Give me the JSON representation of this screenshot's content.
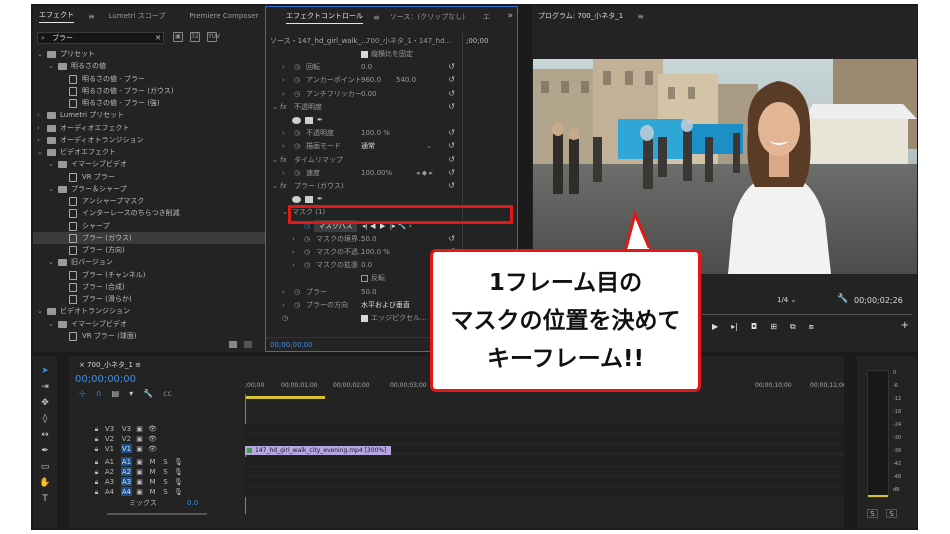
{
  "effects_panel": {
    "tabs": [
      "エフェクト",
      "Lumetri スコープ",
      "Premiere Composer"
    ],
    "search_value": "ブラー",
    "tree": [
      {
        "label": "プリセット",
        "level": 0,
        "type": "folder",
        "expanded": true
      },
      {
        "label": "明るさの値",
        "level": 1,
        "type": "folder",
        "expanded": true
      },
      {
        "label": "明るさの値 - ブラー",
        "level": 2,
        "type": "preset"
      },
      {
        "label": "明るさの値 - ブラー (ガウス)",
        "level": 2,
        "type": "preset"
      },
      {
        "label": "明るさの値 - ブラー (強)",
        "level": 2,
        "type": "preset"
      },
      {
        "label": "Lumetri プリセット",
        "level": 0,
        "type": "folder",
        "expanded": false
      },
      {
        "label": "オーディオエフェクト",
        "level": 0,
        "type": "folder",
        "expanded": false
      },
      {
        "label": "オーディオトランジション",
        "level": 0,
        "type": "folder",
        "expanded": false
      },
      {
        "label": "ビデオエフェクト",
        "level": 0,
        "type": "folder",
        "expanded": true
      },
      {
        "label": "イマーシブビデオ",
        "level": 1,
        "type": "folder",
        "expanded": true
      },
      {
        "label": "VR ブラー",
        "level": 2,
        "type": "effect"
      },
      {
        "label": "ブラー＆シャープ",
        "level": 1,
        "type": "folder",
        "expanded": true
      },
      {
        "label": "アンシャープマスク",
        "level": 2,
        "type": "effect"
      },
      {
        "label": "インターレースのちらつき削減",
        "level": 2,
        "type": "effect"
      },
      {
        "label": "シャープ",
        "level": 2,
        "type": "effect"
      },
      {
        "label": "ブラー (ガウス)",
        "level": 2,
        "type": "effect",
        "selected": true
      },
      {
        "label": "ブラー (方向)",
        "level": 2,
        "type": "effect"
      },
      {
        "label": "旧バージョン",
        "level": 1,
        "type": "folder",
        "expanded": true
      },
      {
        "label": "ブラー (チャンネル)",
        "level": 2,
        "type": "effect"
      },
      {
        "label": "ブラー (合成)",
        "level": 2,
        "type": "effect"
      },
      {
        "label": "ブラー (滑らか)",
        "level": 2,
        "type": "effect"
      },
      {
        "label": "ビデオトランジション",
        "level": 0,
        "type": "folder",
        "expanded": true
      },
      {
        "label": "イマーシブビデオ",
        "level": 1,
        "type": "folder",
        "expanded": true
      },
      {
        "label": "VR ブラー (球面)",
        "level": 2,
        "type": "effect"
      }
    ]
  },
  "effect_controls": {
    "tabs": [
      "エフェクトコントロール",
      "ソース：(クリップなし)",
      "エ"
    ],
    "source_label": "ソース・147_hd_girl_walk_...",
    "seq_label": "700_小ネタ_1・147_hd...",
    "ruler_time": ";00;00",
    "rows": [
      {
        "id": "uniform",
        "indent": 2,
        "label": "",
        "value": "縦横比を固定",
        "kind": "checkbox"
      },
      {
        "id": "rotate",
        "indent": 1,
        "label": "回転",
        "value": "0.0",
        "kind": "param"
      },
      {
        "id": "anchor",
        "indent": 1,
        "label": "アンカーポイント",
        "value": "960.0",
        "value2": "540.0",
        "kind": "param"
      },
      {
        "id": "flicker",
        "indent": 1,
        "label": "アンチフリッカー",
        "value": "0.00",
        "kind": "param"
      },
      {
        "id": "opacity_h",
        "indent": 0,
        "label": "不透明度",
        "kind": "header"
      },
      {
        "id": "opacity_shapes",
        "indent": 1,
        "kind": "shapes"
      },
      {
        "id": "opacity",
        "indent": 1,
        "label": "不透明度",
        "value": "100.0 %",
        "kind": "param"
      },
      {
        "id": "blend",
        "indent": 1,
        "label": "描画モード",
        "value": "通常",
        "kind": "select"
      },
      {
        "id": "timeremap_h",
        "indent": 0,
        "label": "タイムリマップ",
        "kind": "header"
      },
      {
        "id": "speed",
        "indent": 1,
        "label": "速度",
        "value": "100.00%",
        "kind": "param"
      },
      {
        "id": "blur_h",
        "indent": 0,
        "label": "ブラー (ガウス)",
        "kind": "header"
      },
      {
        "id": "blur_shapes",
        "indent": 1,
        "kind": "shapes"
      },
      {
        "id": "mask_h",
        "indent": 1,
        "label": "マスク (1)",
        "kind": "subheader"
      },
      {
        "id": "maskpath",
        "indent": 2,
        "label": "マスクパス",
        "kind": "maskpath"
      },
      {
        "id": "feather",
        "indent": 2,
        "label": "マスクの境界...",
        "value": "50.0",
        "kind": "param"
      },
      {
        "id": "maskopac",
        "indent": 2,
        "label": "マスクの不透...",
        "value": "100.0 %",
        "kind": "param"
      },
      {
        "id": "expand",
        "indent": 2,
        "label": "マスクの拡張",
        "value": "0.0",
        "kind": "param"
      },
      {
        "id": "invert",
        "indent": 2,
        "label": "",
        "value": "反転",
        "kind": "checkbox_off"
      },
      {
        "id": "blurriness",
        "indent": 1,
        "label": "ブラー",
        "value": "50.0",
        "kind": "param"
      },
      {
        "id": "blurdir",
        "indent": 1,
        "label": "ブラーの方向",
        "value": "水平および垂直",
        "kind": "text"
      },
      {
        "id": "repeat",
        "indent": 1,
        "label": "",
        "value": "エッジピクセル...",
        "kind": "checkbox"
      }
    ],
    "timecode": "00;00;00;00"
  },
  "program": {
    "title": "プログラム: 700_小ネタ_1",
    "resolution": "1/4",
    "timecode": "00;00;02;26"
  },
  "timeline": {
    "title": "700_小ネタ_1",
    "timecode": "00;00;00;00",
    "ruler": [
      ";00;00",
      "00;00;01;00",
      "00;00;02;00",
      "00;00;03;00",
      "00;00;10;00",
      "00;00;11;00",
      "00;00"
    ],
    "video_tracks": [
      "V3",
      "V2",
      "V1"
    ],
    "audio_tracks": [
      "A1",
      "A2",
      "A3",
      "A4"
    ],
    "mix_label": "ミックス",
    "mix_value": "0.0",
    "clip_name": "147_hd_girl_walk_city_evening.mp4 [300%]",
    "track_letters": {
      "m": "M",
      "s": "S"
    }
  },
  "meter": {
    "scale": [
      "0",
      "-6",
      "-12",
      "-18",
      "-24",
      "-30",
      "-36",
      "-42",
      "-48",
      "dB"
    ],
    "solo": [
      "S",
      "S"
    ]
  },
  "callout": {
    "lines": [
      "1フレーム目の",
      "マスクの位置を決めて",
      "キーフレーム!!"
    ]
  },
  "colors": {
    "accent": "#3e8ee6",
    "callout_border": "#e01818",
    "clip": "#b7a6e3"
  }
}
